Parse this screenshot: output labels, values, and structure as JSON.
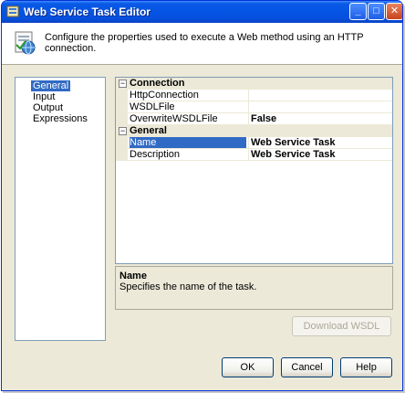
{
  "window": {
    "title": "Web Service Task Editor"
  },
  "titlebar": {
    "minimize": "_",
    "maximize": "□",
    "close": "✕"
  },
  "header": {
    "text": "Configure the properties used to execute a Web method using an HTTP connection."
  },
  "nav": {
    "items": [
      {
        "label": "General",
        "selected": true
      },
      {
        "label": "Input",
        "selected": false
      },
      {
        "label": "Output",
        "selected": false
      },
      {
        "label": "Expressions",
        "selected": false
      }
    ]
  },
  "grid": {
    "categories": [
      {
        "label": "Connection",
        "toggle": "⊟",
        "properties": [
          {
            "name": "HttpConnection",
            "value": ""
          },
          {
            "name": "WSDLFile",
            "value": ""
          },
          {
            "name": "OverwriteWSDLFile",
            "value": "False"
          }
        ]
      },
      {
        "label": "General",
        "toggle": "⊟",
        "properties": [
          {
            "name": "Name",
            "value": "Web Service Task",
            "selected": true
          },
          {
            "name": "Description",
            "value": "Web Service Task"
          }
        ]
      }
    ]
  },
  "description": {
    "title": "Name",
    "text": "Specifies the name of the task."
  },
  "buttons": {
    "download": "Download WSDL",
    "ok": "OK",
    "cancel": "Cancel",
    "help": "Help"
  },
  "colors": {
    "title_bar": "#0554e3",
    "selection": "#316ac5",
    "dialog_bg": "#ece9d8"
  }
}
